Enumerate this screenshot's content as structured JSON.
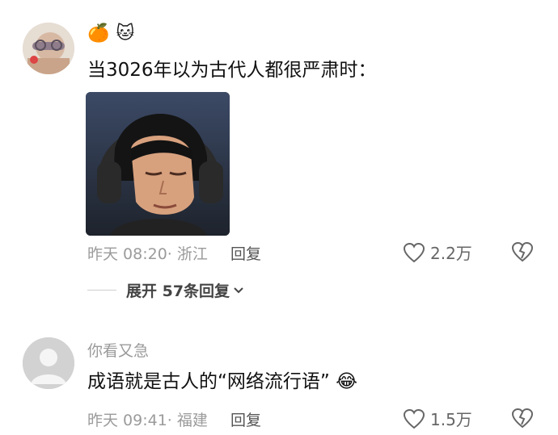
{
  "comments": [
    {
      "username": "",
      "emojis": [
        "🍊",
        "🐱"
      ],
      "text": "当3026年以为古代人都很严肃时：",
      "has_image": true,
      "time": "昨天 08:20",
      "location": "浙江",
      "reply_label": "回复",
      "likes": "2.2万",
      "expand_label": "展开 57条回复"
    },
    {
      "username": "你看又急",
      "text": "成语就是古人的“网络流行语”",
      "trailing_emoji": "😂",
      "time": "昨天 09:41",
      "location": "福建",
      "reply_label": "回复",
      "likes": "1.5万"
    }
  ],
  "colors": {
    "meta": "#9b9b9b",
    "text": "#111111",
    "icon": "#666666"
  }
}
